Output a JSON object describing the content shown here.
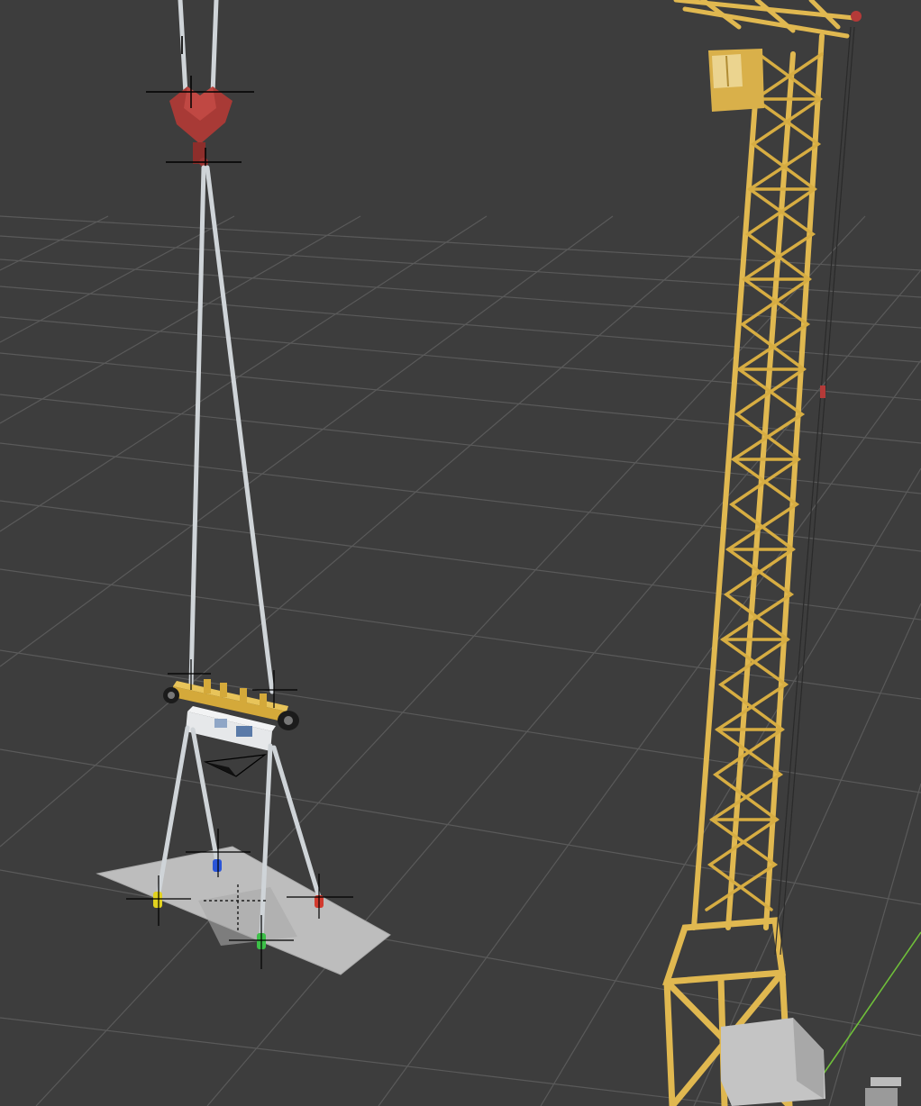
{
  "viewport": {
    "background": "#3d3d3d",
    "grid_color": "#5a5a5a",
    "axis_y_color": "#6fbf3a"
  },
  "colors": {
    "crane_yellow": "#e0b850",
    "crane_shadow": "#a8852f",
    "cable": "#cfd4d8",
    "hook_block": "#a83a36",
    "spreader_bar": "#d4a93a",
    "load_body": "#e6e8ea",
    "plate": "#bdbdbd",
    "marker_yellow": "#e2d21f",
    "marker_blue": "#2a55d8",
    "marker_green": "#3cc048",
    "marker_red": "#d23a2e",
    "empty_axes": "#000000"
  },
  "objects": [
    "tower-crane",
    "crane-cab",
    "hoist-cables",
    "hook-block",
    "spreader-bar",
    "load-module",
    "lifting-slings",
    "ground-plate",
    "anchor-yellow",
    "anchor-blue",
    "anchor-green",
    "anchor-red",
    "crane-base-unit"
  ],
  "icons": {
    "empty": "plain-axes-icon",
    "anchor": "tag-marker-icon"
  }
}
